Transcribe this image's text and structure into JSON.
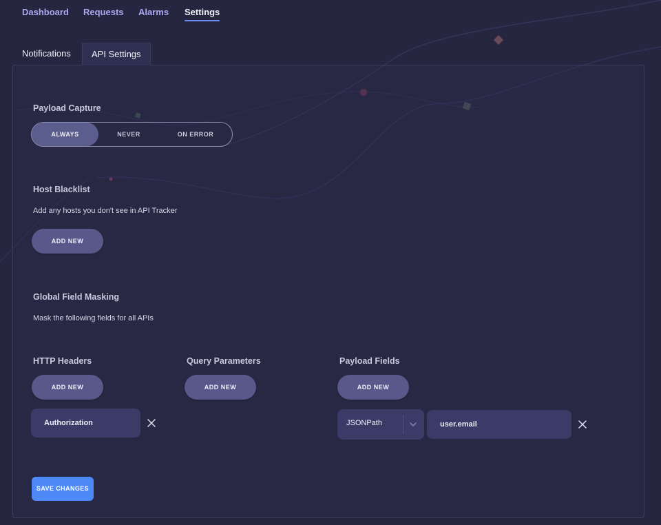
{
  "nav": {
    "items": [
      {
        "label": "Dashboard"
      },
      {
        "label": "Requests"
      },
      {
        "label": "Alarms"
      },
      {
        "label": "Settings"
      }
    ],
    "active": "Settings"
  },
  "tabs": [
    {
      "label": "Notifications"
    },
    {
      "label": "API Settings"
    }
  ],
  "payload_capture": {
    "title": "Payload Capture",
    "options": [
      "ALWAYS",
      "NEVER",
      "ON ERROR"
    ],
    "selected": "ALWAYS"
  },
  "host_blacklist": {
    "title": "Host Blacklist",
    "description": "Add any hosts you don't see in API Tracker",
    "add_label": "ADD NEW"
  },
  "masking": {
    "title": "Global Field Masking",
    "description": "Mask the following fields for all APIs",
    "http_headers": {
      "title": "HTTP Headers",
      "add_label": "ADD NEW",
      "items": [
        "Authorization"
      ]
    },
    "query_params": {
      "title": "Query Parameters",
      "add_label": "ADD NEW"
    },
    "payload_fields": {
      "title": "Payload Fields",
      "add_label": "ADD NEW",
      "type_value": "JSONPath",
      "field_value": "user.email"
    }
  },
  "save_label": "SAVE CHANGES",
  "colors": {
    "background": "#262640",
    "accent": "#4d8af7",
    "button": "#58598a",
    "field": "#3a3b66"
  }
}
